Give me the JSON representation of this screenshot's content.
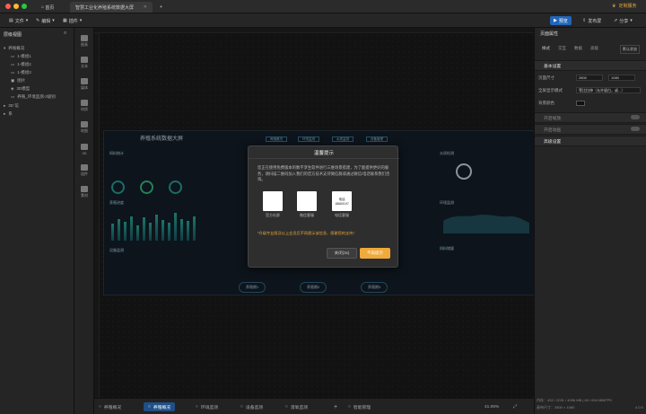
{
  "titlebar": {
    "tabs": [
      {
        "label": "首页"
      },
      {
        "label": "智慧工业化养殖系统数据大屏"
      }
    ],
    "account": "定制服务"
  },
  "toolbar": {
    "file": "文件",
    "edit": "编辑",
    "extra": "插件",
    "preview": "预览",
    "publish": "发布屏",
    "share": "分享"
  },
  "left_panel": {
    "title": "层级视图",
    "items": [
      {
        "label": "养殖概况"
      },
      {
        "label": "1-模组1"
      },
      {
        "label": "1-模组2"
      },
      {
        "label": "1-模组3"
      },
      {
        "label": "图片"
      },
      {
        "label": "3D模型"
      },
      {
        "label": "养殖_环境监测-2级别"
      },
      {
        "label": "3D 馆"
      },
      {
        "label": "系"
      }
    ]
  },
  "rail": {
    "items": [
      {
        "label": "图表"
      },
      {
        "label": "文本"
      },
      {
        "label": "媒体"
      },
      {
        "label": "材质"
      },
      {
        "label": "地图"
      },
      {
        "label": "3D"
      },
      {
        "label": "组件"
      },
      {
        "label": "素材"
      }
    ]
  },
  "dashboard": {
    "title": "养殖系统数据大屏",
    "nav": [
      "养殖概况",
      "环境监测",
      "水质监测",
      "设备管理"
    ],
    "left_sections": [
      "饲料统计",
      "养殖进度",
      "设备监测"
    ],
    "right_sections": [
      "水质检测",
      "环境监测",
      "饲料储量"
    ],
    "stages": [
      "养殖期1",
      "养殖期2",
      "养殖期3"
    ],
    "bar_levels": [
      0.55,
      0.7,
      0.62,
      0.8,
      0.5,
      0.75,
      0.6,
      0.85,
      0.68,
      0.58,
      0.9,
      0.72,
      0.64,
      0.78
    ]
  },
  "modal": {
    "title": "温馨提示",
    "body": "您正在使用免费版本的数字孪生软件进行三维场景搭建，为了能提供更好的服务，请扫描二维码加入我们的官方技术支持微信群或通过微信/电话联系我们咨询。",
    "qr_labels": [
      "官方社群",
      "微信客服",
      "电话客服"
    ],
    "phone_label": "电话",
    "phone_number": "18660197",
    "warning": "*升级专业版及以上会员后不再提示该信息，感谢您的支持！",
    "close_button": "关闭(3s)",
    "confirm_button": "不再提示"
  },
  "right_panel": {
    "title": "页面属性",
    "tabs": [
      "样式",
      "交互",
      "数据",
      "高级"
    ],
    "badge": "默认状态",
    "section_basic": "基本设置",
    "size_label": "页面尺寸",
    "width": "2800",
    "height": "1080",
    "scale_label": "全屏显示模式",
    "scale_value": "等比拉伸（允许留白，或...）",
    "bg_label": "背景颜色",
    "toggle1": "开启缩放",
    "toggle2": "开启动画",
    "section_advanced": "高级设置"
  },
  "bottombar": {
    "tabs": [
      "养殖概况",
      "养殖概况",
      "环境监测",
      "设备监测",
      "溶氧监测",
      "智能管理"
    ],
    "zoom": "41.06%"
  },
  "status": {
    "line1": "内存：432 / 2031 / 4096 MB | 60 / 694 MB/FPS",
    "line2": "画布尺寸：2800 × 1080",
    "version": "4.0.0"
  }
}
